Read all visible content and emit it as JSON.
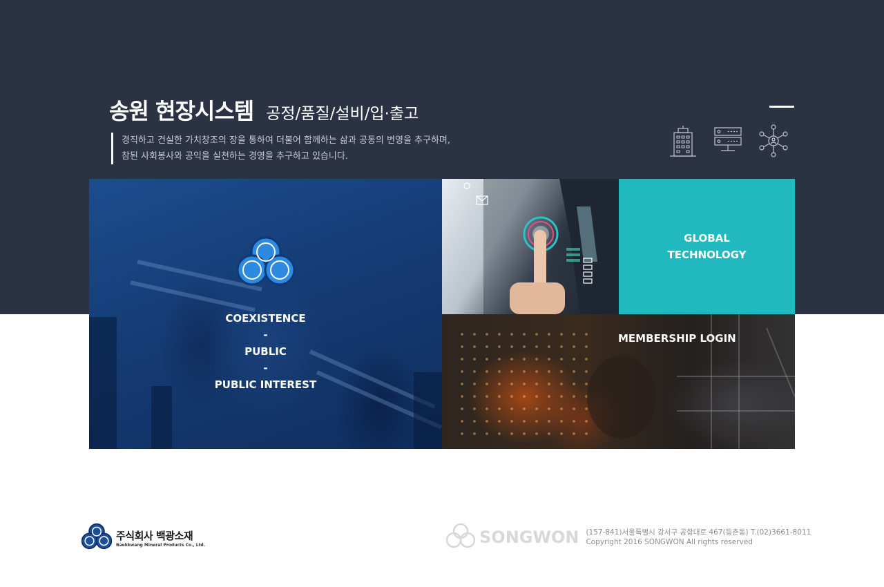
{
  "header": {
    "title_main": "송원 현장시스템",
    "title_sub": "공정/품질/설비/입·출고",
    "tagline_line1": "경직하고 건실한 가치창조의 장을 통하여 더불어 함께하는 삶과 공동의 번영을 추구하며,",
    "tagline_line2": "참된 사회봉사와 공익을 실천하는 경영을 추구하고 있습니다.",
    "icons": [
      "building-icon",
      "server-icon",
      "network-icon"
    ]
  },
  "tiles": {
    "left": {
      "line1": "COEXISTENCE",
      "sep1": "-",
      "line2": "PUBLIC",
      "sep2": "-",
      "line3": "PUBLIC INTEREST"
    },
    "global": {
      "line1": "GLOBAL",
      "line2": "TECHNOLOGY"
    },
    "member": {
      "label": "MEMBERSHIP LOGIN"
    }
  },
  "footer": {
    "company_ko": "주식회사 백광소재",
    "company_en": "Baekkwang Mineral Products Co., Ltd.",
    "songwon": "SONGWON",
    "address": "(157-841)서울특별시 강서구 공항대로 467(등촌동) T.(02)3661-8011",
    "copyright": "Copyright 2016 SONGWON All rights reserved"
  },
  "colors": {
    "band": "#2a3243",
    "teal": "#21b8c0",
    "brand_blue": "#1f6fc2"
  }
}
